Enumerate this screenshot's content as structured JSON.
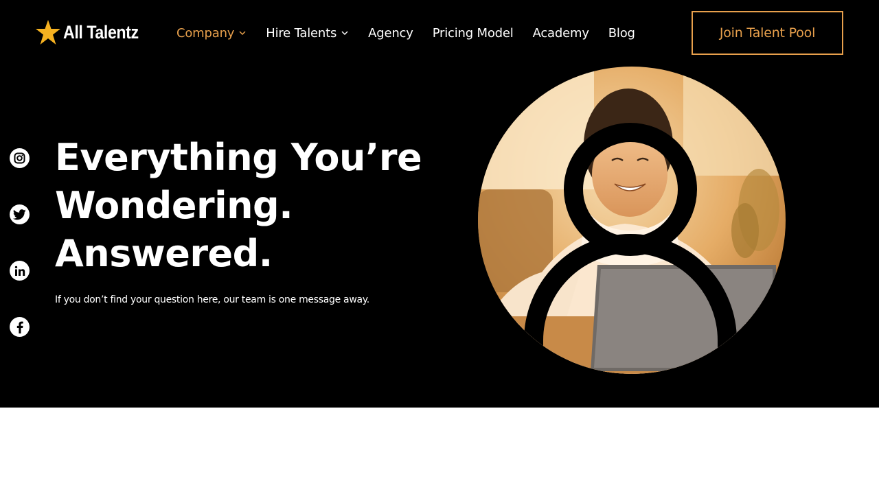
{
  "brand": {
    "name": "All Talentz",
    "star_color": "#f5b120"
  },
  "nav": {
    "items": [
      {
        "label": "Company",
        "has_dropdown": true,
        "active": true
      },
      {
        "label": "Hire Talents",
        "has_dropdown": true,
        "active": false
      },
      {
        "label": "Agency",
        "has_dropdown": false,
        "active": false
      },
      {
        "label": "Pricing Model",
        "has_dropdown": false,
        "active": false
      },
      {
        "label": "Academy",
        "has_dropdown": false,
        "active": false
      },
      {
        "label": "Blog",
        "has_dropdown": false,
        "active": false
      }
    ],
    "cta_label": "Join Talent Pool"
  },
  "socials": [
    {
      "icon": "instagram-icon"
    },
    {
      "icon": "twitter-icon"
    },
    {
      "icon": "linkedin-icon"
    },
    {
      "icon": "facebook-icon"
    }
  ],
  "hero": {
    "headline_lines": [
      "Everything You’re",
      "Wondering.",
      "Answered."
    ],
    "subtext": "If you don’t find your question here, our team is one message away.",
    "image": "woman-smiling-at-laptop-photo"
  },
  "colors": {
    "accent": "#e8a04c",
    "background": "#000000",
    "text": "#ffffff"
  }
}
